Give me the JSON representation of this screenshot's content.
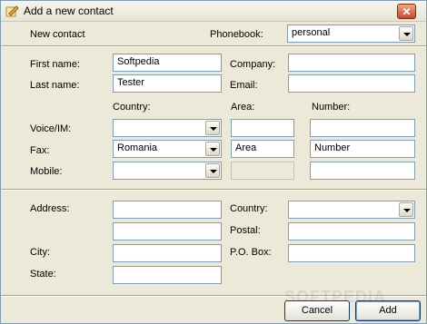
{
  "window": {
    "title": "Add a new contact",
    "close_label": "✕"
  },
  "header": {
    "new_contact_label": "New contact",
    "phonebook_label": "Phonebook:",
    "phonebook_value": "personal"
  },
  "name_section": {
    "first_name_label": "First name:",
    "first_name_value": "Softpedia",
    "last_name_label": "Last name:",
    "last_name_value": "Tester",
    "company_label": "Company:",
    "company_value": "",
    "email_label": "Email:",
    "email_value": ""
  },
  "phone_section": {
    "country_header": "Country:",
    "area_header": "Area:",
    "number_header": "Number:",
    "voice_label": "Voice/IM:",
    "voice_country": "",
    "voice_area": "",
    "voice_number": "",
    "fax_label": "Fax:",
    "fax_country": "Romania",
    "fax_area": "Area",
    "fax_number": "Number",
    "mobile_label": "Mobile:",
    "mobile_country": "",
    "mobile_number": ""
  },
  "address_section": {
    "address_label": "Address:",
    "address_line1": "",
    "address_line2": "",
    "city_label": "City:",
    "city_value": "",
    "state_label": "State:",
    "state_value": "",
    "country_label": "Country:",
    "country_value": "",
    "postal_label": "Postal:",
    "postal_value": "",
    "pobox_label": "P.O. Box:",
    "pobox_value": ""
  },
  "buttons": {
    "cancel_label": "Cancel",
    "add_label": "Add"
  },
  "watermark": "SOFTPEDIA",
  "icons": {
    "title_icon": "notepad-pencil-icon",
    "dropdown": "chevron-down-icon"
  }
}
